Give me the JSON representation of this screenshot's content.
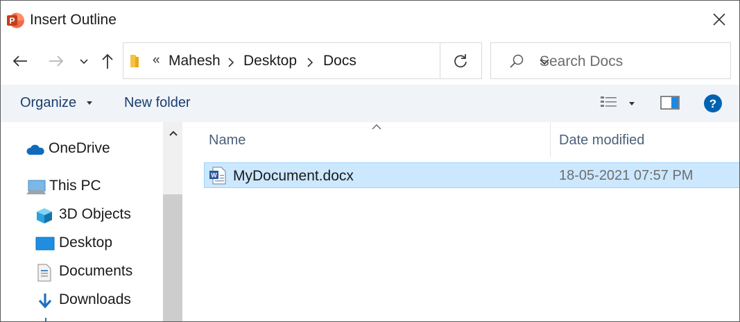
{
  "title": "Insert Outline",
  "breadcrumb": {
    "overflow": "«",
    "items": [
      "Mahesh",
      "Desktop",
      "Docs"
    ]
  },
  "search": {
    "placeholder": "Search Docs"
  },
  "toolbar": {
    "organize": "Organize",
    "new_folder": "New folder"
  },
  "nav_pane": {
    "items": [
      {
        "label": "OneDrive",
        "icon": "onedrive-icon"
      },
      {
        "label": "This PC",
        "icon": "this-pc-icon"
      },
      {
        "label": "3D Objects",
        "icon": "3d-objects-icon"
      },
      {
        "label": "Desktop",
        "icon": "desktop-icon"
      },
      {
        "label": "Documents",
        "icon": "documents-icon"
      },
      {
        "label": "Downloads",
        "icon": "downloads-icon"
      }
    ]
  },
  "columns": {
    "name": "Name",
    "date_modified": "Date modified"
  },
  "files": [
    {
      "name": "MyDocument.docx",
      "date_modified": "18-05-2021 07:57 PM",
      "icon": "word-document-icon",
      "selected": true
    }
  ],
  "colors": {
    "accent": "#0063b1",
    "selection": "#cce8ff",
    "command_bar": "#f0f4f9",
    "link_text": "#1a3d6d"
  }
}
